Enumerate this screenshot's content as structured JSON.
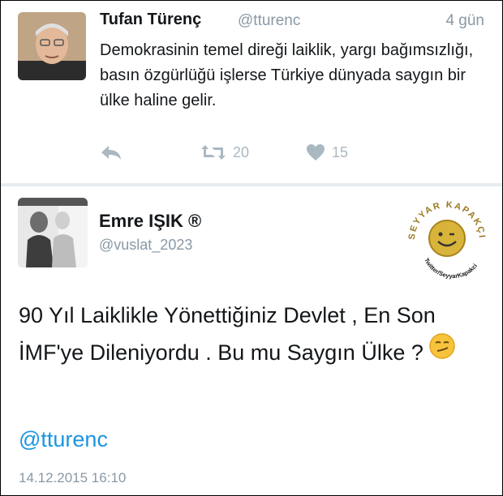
{
  "tweet1": {
    "author_name": "Tufan Türenç",
    "handle": "@tturenc",
    "time": "4 gün",
    "text": "Demokrasinin temel direği laiklik, yargı bağımsızlığı, basın özgürlüğü işlerse Türkiye dünyada saygın bir ülke haline gelir.",
    "actions": {
      "reply_icon": "reply-icon",
      "retweet_icon": "retweet-icon",
      "retweet_count": "20",
      "like_icon": "heart-icon",
      "like_count": "15"
    }
  },
  "tweet2": {
    "author_name": "Emre IŞIK ®",
    "handle": "@vuslat_2023",
    "text": "90 Yıl Laiklikle Yönettiğiniz Devlet , En Son İMF'ye Dileniyordu . Bu mu Saygın Ülke ?",
    "emoji": "smirking-face-emoji",
    "mention": "@tturenc",
    "date": "14.12.2015 16:10"
  },
  "watermark": {
    "top_text": "SEYYAR KAPAKÇI",
    "bottom_text": "Twitter/SeyyarKapakci",
    "color": "#c9a227"
  },
  "colors": {
    "text": "#14171a",
    "secondary": "#8899a6",
    "action": "#aab8c2",
    "link": "#1b95e0",
    "divider": "#e6ecf0"
  }
}
